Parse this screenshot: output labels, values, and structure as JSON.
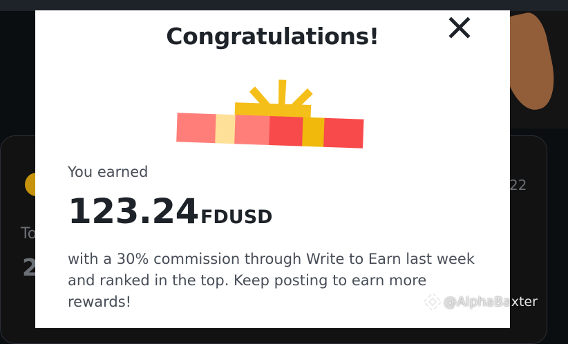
{
  "modal": {
    "title": "Congratulations!",
    "earned_label": "You earned",
    "amount": "123.24",
    "currency": "FDUSD",
    "description": "with a 30% commission through Write to Earn last week and ranked in the top. Keep posting to earn more rewards!"
  },
  "background": {
    "side_number_fragment": "22",
    "label_fragment": "To",
    "value_fragment": "2"
  },
  "watermark": {
    "text": "@AlphaBaxter"
  },
  "colors": {
    "gift_ribbon": "#f5bf1a",
    "gift_stripes": [
      "#ff7e79",
      "#ffe098",
      "#ff7e79",
      "#f84a4a",
      "#f0b90b",
      "#f84a4a"
    ],
    "brand_accent": "#f0b90b",
    "background_dark": "#0b0e11"
  },
  "icons": [
    "close-icon",
    "gift-icon",
    "binance-logo-icon"
  ]
}
